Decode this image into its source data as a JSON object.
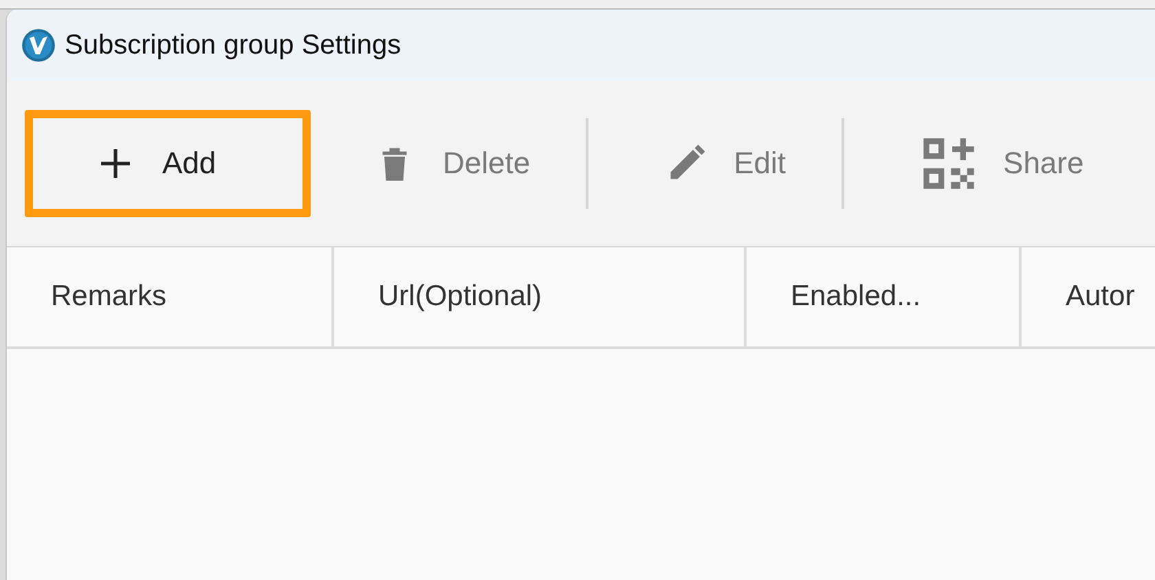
{
  "window": {
    "title": "Subscription group Settings"
  },
  "toolbar": [
    {
      "kind": "add",
      "label": "Add",
      "disabled": false,
      "highlighted": true
    },
    {
      "kind": "delete",
      "label": "Delete",
      "disabled": true,
      "highlighted": false
    },
    {
      "kind": "edit",
      "label": "Edit",
      "disabled": true,
      "highlighted": false
    },
    {
      "kind": "share",
      "label": "Share",
      "disabled": true,
      "highlighted": false
    }
  ],
  "table": {
    "columns": [
      "Remarks",
      "Url(Optional)",
      "Enabled...",
      "Autor"
    ]
  }
}
